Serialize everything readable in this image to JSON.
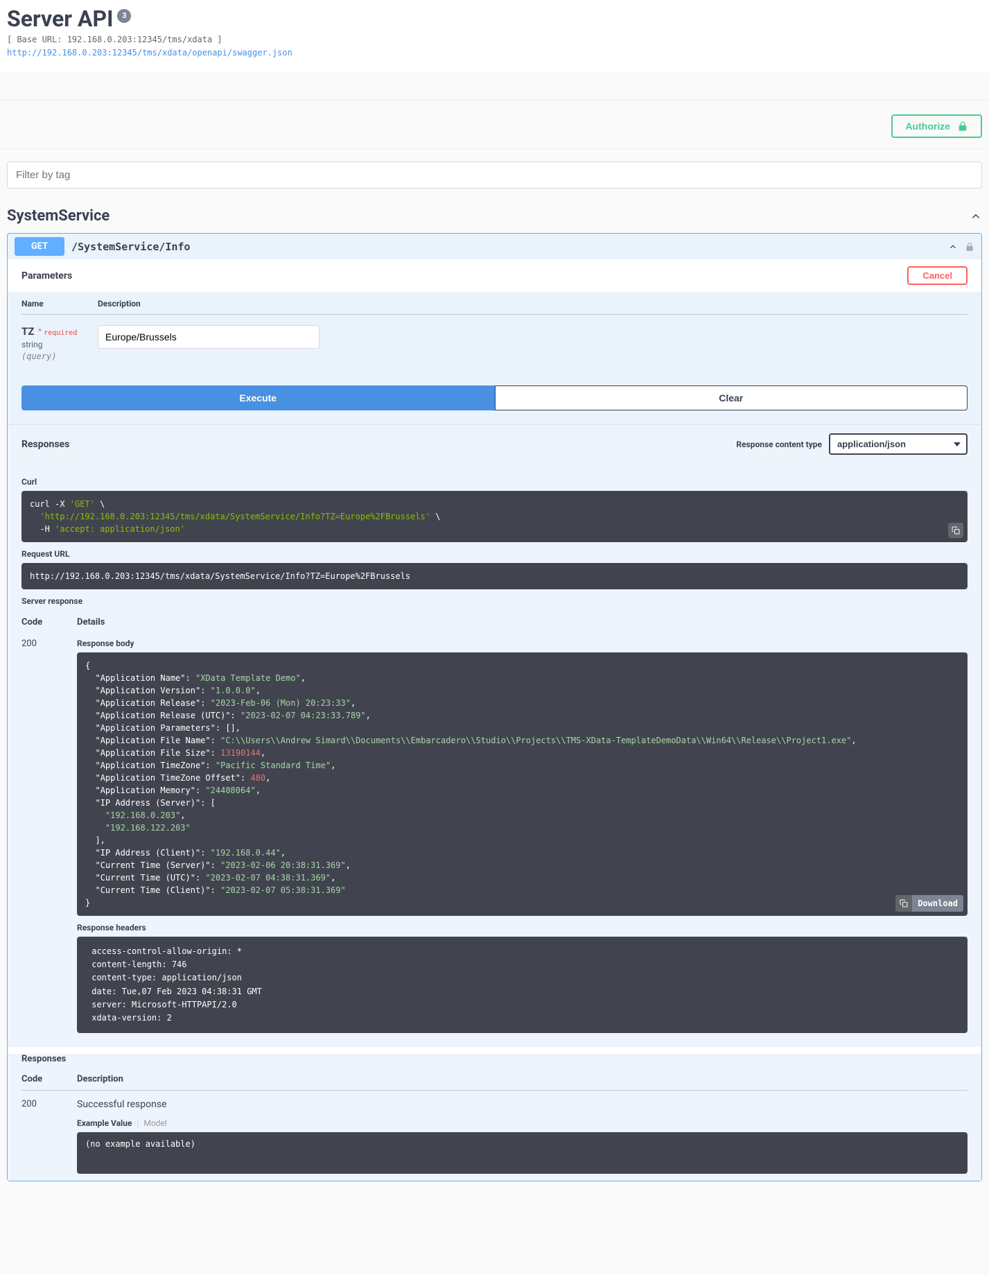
{
  "header": {
    "title": "Server API",
    "badge": "3",
    "baseUrl": "[ Base URL: 192.168.0.203:12345/tms/xdata ]",
    "specLink": "http://192.168.0.203:12345/tms/xdata/openapi/swagger.json"
  },
  "authorize": "Authorize",
  "filterPlaceholder": "Filter by tag",
  "tag": {
    "name": "SystemService"
  },
  "operation": {
    "method": "GET",
    "path": "/SystemService/Info",
    "parametersLabel": "Parameters",
    "cancel": "Cancel",
    "paramHeaders": {
      "name": "Name",
      "desc": "Description"
    },
    "param": {
      "name": "TZ",
      "required": "required",
      "type": "string",
      "location": "(query)",
      "value": "Europe/Brussels"
    },
    "execute": "Execute",
    "clear": "Clear"
  },
  "responses": {
    "label": "Responses",
    "contentTypeLabel": "Response content type",
    "contentType": "application/json",
    "curlLabel": "Curl",
    "curl": {
      "line1": "curl -X ",
      "method": "'GET'",
      "slash": " \\",
      "urlIndent": "  ",
      "url": "'http://192.168.0.203:12345/tms/xdata/SystemService/Info?TZ=Europe%2FBrussels'",
      "hdrIndent": "  -H ",
      "hdr": "'accept: application/json'"
    },
    "requestUrlLabel": "Request URL",
    "requestUrl": "http://192.168.0.203:12345/tms/xdata/SystemService/Info?TZ=Europe%2FBrussels",
    "serverResponseLabel": "Server response",
    "codeHeader": "Code",
    "detailsHeader": "Details",
    "code": "200",
    "responseBodyLabel": "Response body",
    "body": {
      "appName": {
        "k": "Application Name",
        "v": "XData Template Demo"
      },
      "appVer": {
        "k": "Application Version",
        "v": "1.0.0.0"
      },
      "appRel": {
        "k": "Application Release",
        "v": "2023-Feb-06 (Mon) 20:23:33"
      },
      "appRelUtc": {
        "k": "Application Release (UTC)",
        "v": "2023-02-07 04:23:33.789"
      },
      "appParams": {
        "k": "Application Parameters",
        "v": "[]"
      },
      "appFile": {
        "k": "Application File Name",
        "v": "C:\\\\Users\\\\Andrew Simard\\\\Documents\\\\Embarcadero\\\\Studio\\\\Projects\\\\TMS-XData-TemplateDemoData\\\\Win64\\\\Release\\\\Project1.exe"
      },
      "appSize": {
        "k": "Application File Size",
        "v": "13190144"
      },
      "appTz": {
        "k": "Application TimeZone",
        "v": "Pacific Standard Time"
      },
      "appTzOff": {
        "k": "Application TimeZone Offset",
        "v": "480"
      },
      "appMem": {
        "k": "Application Memory",
        "v": "24408064"
      },
      "ipServ": {
        "k": "IP Address (Server)"
      },
      "ip1": "192.168.0.203",
      "ip2": "192.168.122.203",
      "ipClient": {
        "k": "IP Address (Client)",
        "v": "192.168.0.44"
      },
      "curServ": {
        "k": "Current Time (Server)",
        "v": "2023-02-06 20:38:31.369"
      },
      "curUtc": {
        "k": "Current Time (UTC)",
        "v": "2023-02-07 04:38:31.369"
      },
      "curClient": {
        "k": "Current Time (Client)",
        "v": "2023-02-07 05:38:31.369"
      }
    },
    "download": "Download",
    "responseHeadersLabel": "Response headers",
    "headers": " access-control-allow-origin: * \n content-length: 746 \n content-type: application/json \n date: Tue,07 Feb 2023 04:38:31 GMT \n server: Microsoft-HTTPAPI/2.0 \n xdata-version: 2 "
  },
  "docResponses": {
    "label": "Responses",
    "codeHeader": "Code",
    "descHeader": "Description",
    "code": "200",
    "desc": "Successful response",
    "exampleValue": "Example Value",
    "model": "Model",
    "noExample": "(no example available)"
  }
}
